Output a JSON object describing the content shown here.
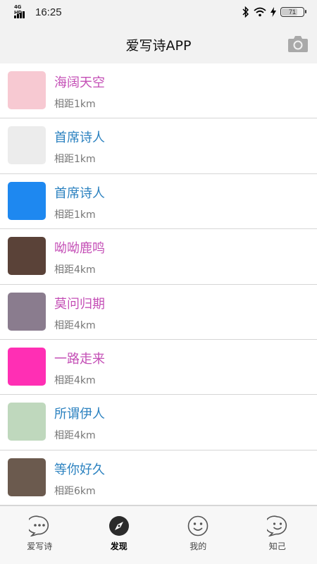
{
  "status": {
    "network": "4G HD",
    "time": "16:25",
    "battery": "71"
  },
  "header": {
    "title": "爱写诗APP"
  },
  "users": [
    {
      "name": "海阔天空",
      "distance": "相距1km",
      "name_color": "#c44fb6",
      "avatar_color": "#f7c9d2",
      "avatar_icon": "girl-cartoon-avatar"
    },
    {
      "name": "首席诗人",
      "distance": "相距1km",
      "name_color": "#2c82c0",
      "avatar_color": "#ececec",
      "avatar_icon": "ancient-poet-drawing-avatar"
    },
    {
      "name": "首席诗人",
      "distance": "相距1km",
      "name_color": "#2c82c0",
      "avatar_color": "#1e88f0",
      "avatar_icon": "blue-square-avatar"
    },
    {
      "name": "呦呦鹿鸣",
      "distance": "相距4km",
      "name_color": "#c44fb6",
      "avatar_color": "#5a4238",
      "avatar_icon": "girl-photo-avatar"
    },
    {
      "name": "莫问归期",
      "distance": "相距4km",
      "name_color": "#c44fb6",
      "avatar_color": "#8a7c8e",
      "avatar_icon": "woodblock-print-avatar"
    },
    {
      "name": "一路走来",
      "distance": "相距4km",
      "name_color": "#c44fb6",
      "avatar_color": "#ff2fb4",
      "avatar_icon": "pink-square-avatar"
    },
    {
      "name": "所谓伊人",
      "distance": "相距4km",
      "name_color": "#2c82c0",
      "avatar_color": "#bfd8bd",
      "avatar_icon": "watercolor-scene-avatar"
    },
    {
      "name": "等你好久",
      "distance": "相距6km",
      "name_color": "#2c82c0",
      "avatar_color": "#6b5a4e",
      "avatar_icon": "woman-with-hat-avatar"
    }
  ],
  "tabs": [
    {
      "label": "爱写诗",
      "icon": "chat-bubble-icon",
      "active": false
    },
    {
      "label": "发现",
      "icon": "compass-icon",
      "active": true
    },
    {
      "label": "我的",
      "icon": "smiley-icon",
      "active": false
    },
    {
      "label": "知己",
      "icon": "chat-smile-icon",
      "active": false
    }
  ]
}
